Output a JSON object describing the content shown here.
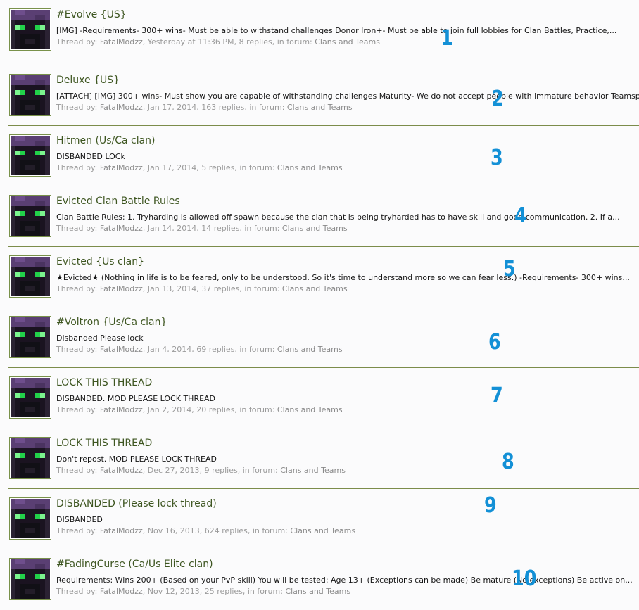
{
  "meta_labels": {
    "thread_by": "Thread by:",
    "replies_suffix": "replies, in forum:"
  },
  "accent_color": "#3e5621",
  "annotation_color": "#1390d6",
  "threads": [
    {
      "title": "#Evolve {US}",
      "snippet": "[IMG] -Requirements- 300+ wins- Must be able to withstand challenges Donor Iron+- Must be able to join full lobbies for Clan Battles, Practice,...",
      "author": "FatalModzz",
      "date": "Yesterday at 11:36 PM",
      "replies": "8",
      "forum": "Clans and Teams",
      "annotation": "1",
      "avatar_icon": "enderman-avatar-icon"
    },
    {
      "title": "Deluxe {US}",
      "snippet": "[ATTACH] [IMG] 300+ wins- Must show you are capable of withstanding challenges Maturity- We do not accept people with immature behavior Teamsp",
      "author": "FatalModzz",
      "date": "Jan 17, 2014",
      "replies": "163",
      "forum": "Clans and Teams",
      "annotation": "2",
      "avatar_icon": "enderman-avatar-icon"
    },
    {
      "title": "Hitmen (Us/Ca clan)",
      "snippet": "DISBANDED LOCk",
      "author": "FatalModzz",
      "date": "Jan 17, 2014",
      "replies": "5",
      "forum": "Clans and Teams",
      "annotation": "3",
      "avatar_icon": "enderman-avatar-icon"
    },
    {
      "title": "Evicted Clan Battle Rules",
      "snippet": "Clan Battle Rules: 1. Tryharding is allowed off spawn because the clan that is being tryharded has to have skill and good communication. 2. If a...",
      "author": "FatalModzz",
      "date": "Jan 14, 2014",
      "replies": "14",
      "forum": "Clans and Teams",
      "annotation": "4",
      "avatar_icon": "enderman-avatar-icon"
    },
    {
      "title": "Evicted {Us clan}",
      "snippet": "★Evicted★ (Nothing in life is to be feared, only to be understood. So it's time to understand more so we can fear less.) -Requirements- 300+ wins...",
      "author": "FatalModzz",
      "date": "Jan 13, 2014",
      "replies": "37",
      "forum": "Clans and Teams",
      "annotation": "5",
      "avatar_icon": "enderman-avatar-icon"
    },
    {
      "title": "#Voltron {Us/Ca clan}",
      "snippet": "Disbanded Please lock",
      "author": "FatalModzz",
      "date": "Jan 4, 2014",
      "replies": "69",
      "forum": "Clans and Teams",
      "annotation": "6",
      "avatar_icon": "enderman-avatar-icon"
    },
    {
      "title": "LOCK THIS THREAD",
      "snippet": "DISBANDED. MOD PLEASE LOCK THREAD",
      "author": "FatalModzz",
      "date": "Jan 2, 2014",
      "replies": "20",
      "forum": "Clans and Teams",
      "annotation": "7",
      "avatar_icon": "enderman-avatar-icon"
    },
    {
      "title": "LOCK THIS THREAD",
      "snippet": "Don't repost. MOD PLEASE LOCK THREAD",
      "author": "FatalModzz",
      "date": "Dec 27, 2013",
      "replies": "9",
      "forum": "Clans and Teams",
      "annotation": "8",
      "avatar_icon": "enderman-avatar-icon"
    },
    {
      "title": "DISBANDED (Please lock thread)",
      "snippet": "DISBANDED",
      "author": "FatalModzz",
      "date": "Nov 16, 2013",
      "replies": "624",
      "forum": "Clans and Teams",
      "annotation": "9",
      "avatar_icon": "enderman-avatar-icon"
    },
    {
      "title": "#FadingCurse (Ca/Us Elite clan)",
      "snippet": "Requirements: Wins 200+ (Based on your PvP skill) You will be tested: Age 13+ (Exceptions can be made) Be mature (No exceptions) Be active on...",
      "author": "FatalModzz",
      "date": "Nov 12, 2013",
      "replies": "25",
      "forum": "Clans and Teams",
      "annotation": "10",
      "avatar_icon": "enderman-avatar-icon"
    }
  ]
}
